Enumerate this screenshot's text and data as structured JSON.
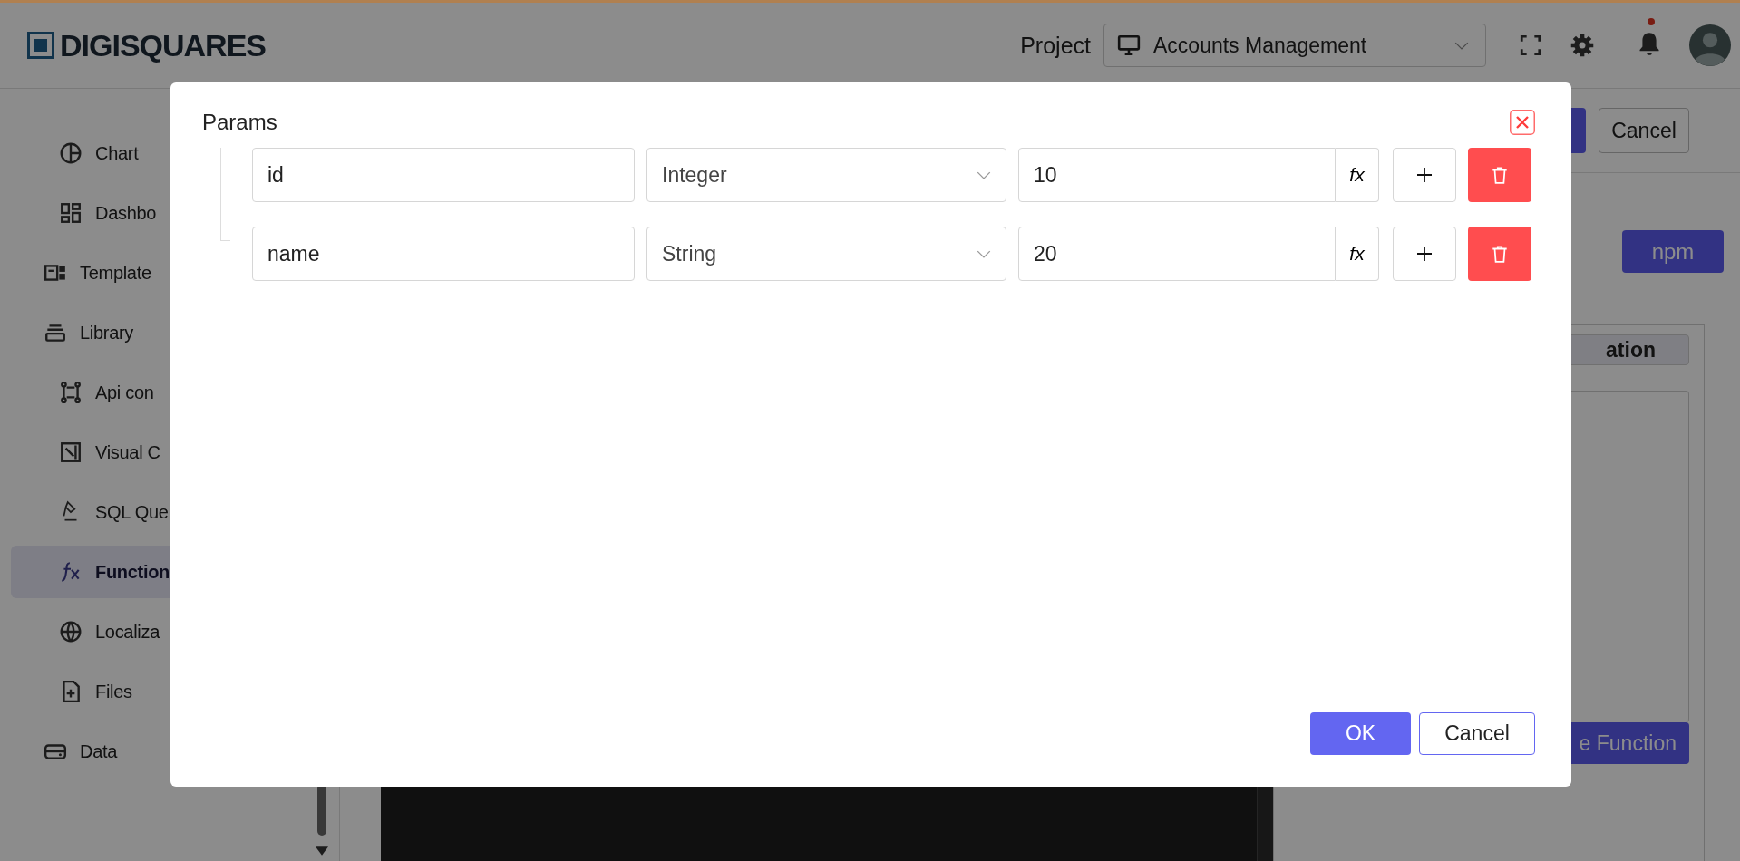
{
  "header": {
    "logo": "DIGISQUARES",
    "project_label": "Project",
    "project": "Accounts Management"
  },
  "sidebar": {
    "clipped_items": [
      {
        "label": "Chart",
        "selected": false
      },
      {
        "label": "Dashbo",
        "selected": false
      }
    ],
    "items": [
      {
        "label": "Template",
        "selected": false
      },
      {
        "label": "Library",
        "selected": false,
        "children": [
          {
            "label": "Api con",
            "selected": false
          },
          {
            "label": "Visual C",
            "selected": false
          },
          {
            "label": "SQL Que",
            "selected": false
          },
          {
            "label": "Function",
            "selected": true
          },
          {
            "label": "Localiza",
            "selected": false
          },
          {
            "label": "Files",
            "selected": false
          }
        ]
      },
      {
        "label": "Data",
        "selected": false
      }
    ]
  },
  "toolbar": {
    "cancel": "Cancel"
  },
  "right_panel": {
    "npm": "npm",
    "tab": "ation",
    "action": "e Function"
  },
  "modal": {
    "title": "Params",
    "rows": [
      {
        "name": "id",
        "type": "Integer",
        "value": "10",
        "addon": "fx"
      },
      {
        "name": "name",
        "type": "String",
        "value": "20",
        "addon": "fx"
      }
    ],
    "ok": "OK",
    "cancel": "Cancel"
  }
}
